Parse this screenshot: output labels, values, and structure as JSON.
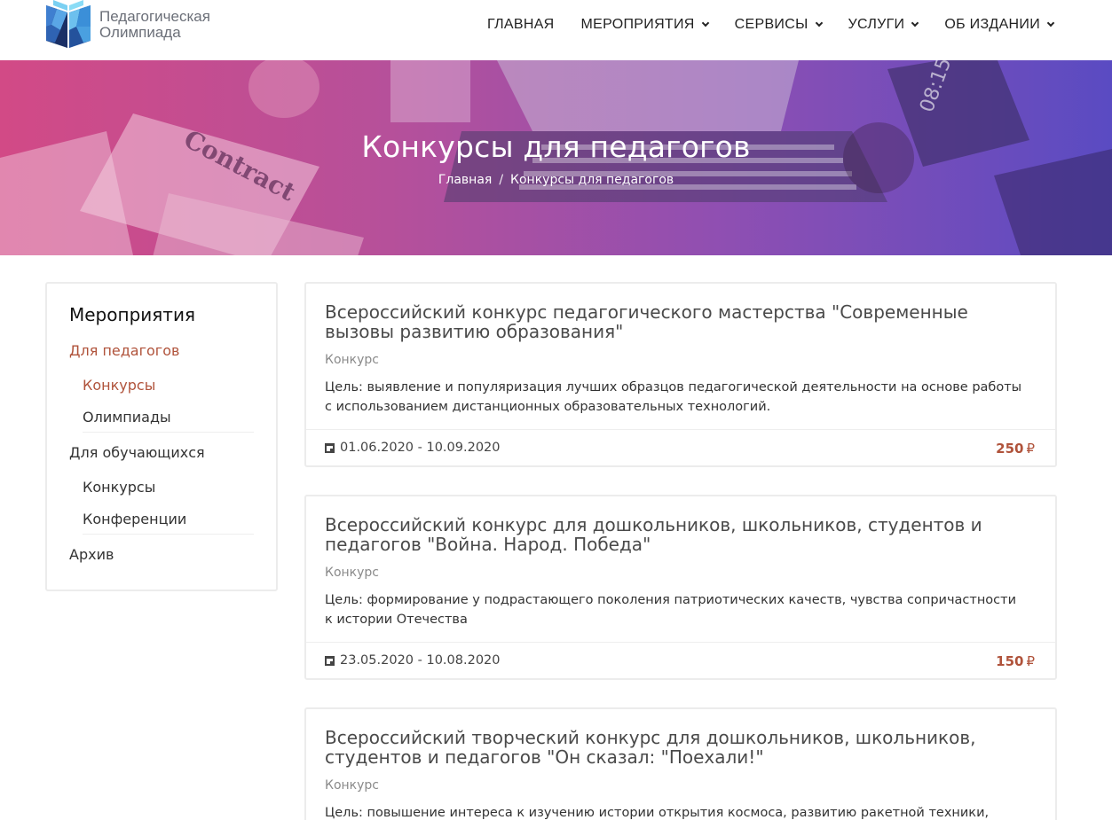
{
  "header": {
    "logo_line1": "Педагогическая",
    "logo_line2": "Олимпиада",
    "nav": [
      {
        "label": "ГЛАВНАЯ"
      },
      {
        "label": "МЕРОПРИЯТИЯ"
      },
      {
        "label": "СЕРВИСЫ"
      },
      {
        "label": "УСЛУГИ"
      },
      {
        "label": "ОБ ИЗДАНИИ"
      }
    ]
  },
  "hero": {
    "title": "Конкурсы для педагогов",
    "breadcrumb": [
      "Главная",
      "Конкурсы для педагогов"
    ],
    "separator": "/"
  },
  "sidebar": {
    "title": "Мероприятия",
    "groups": [
      {
        "label": "Для педагогов",
        "items": [
          "Конкурсы",
          "Олимпиады"
        ]
      },
      {
        "label": "Для обучающихся",
        "items": [
          "Конкурсы",
          "Конференции"
        ]
      },
      {
        "label": "Архив"
      }
    ]
  },
  "cards": [
    {
      "title": "Всероссийский конкурс педагогического мастерства \"Современные вызовы развитию образования\"",
      "type": "Конкурс",
      "description": "Цель: выявление и популяризация лучших образцов педагогической деятельности на основе работы с использованием дистанционных образовательных технологий.",
      "dates": "01.06.2020 - 10.09.2020",
      "price": "250",
      "currency": "₽"
    },
    {
      "title": "Всероссийский конкурс для дошкольников, школьников, студентов и педагогов \"Война. Народ. Победа\"",
      "type": "Конкурс",
      "description": "Цель: формирование у подрастающего поколения патриотических качеств, чувства сопричастности к истории Отечества",
      "dates": "23.05.2020 - 10.08.2020",
      "price": "150",
      "currency": "₽"
    },
    {
      "title": "Всероссийский творческий конкурс для дошкольников, школьников, студентов и педагогов \"Он сказал: \"Поехали!\"",
      "type": "Конкурс",
      "description": "Цель: повышение интереса к изучению истории открытия космоса, развитию ракетной техники, жизни"
    }
  ],
  "colors": {
    "accent": "#b0533b",
    "hero_left": "#d24a86",
    "hero_right": "#5a4bc2"
  }
}
